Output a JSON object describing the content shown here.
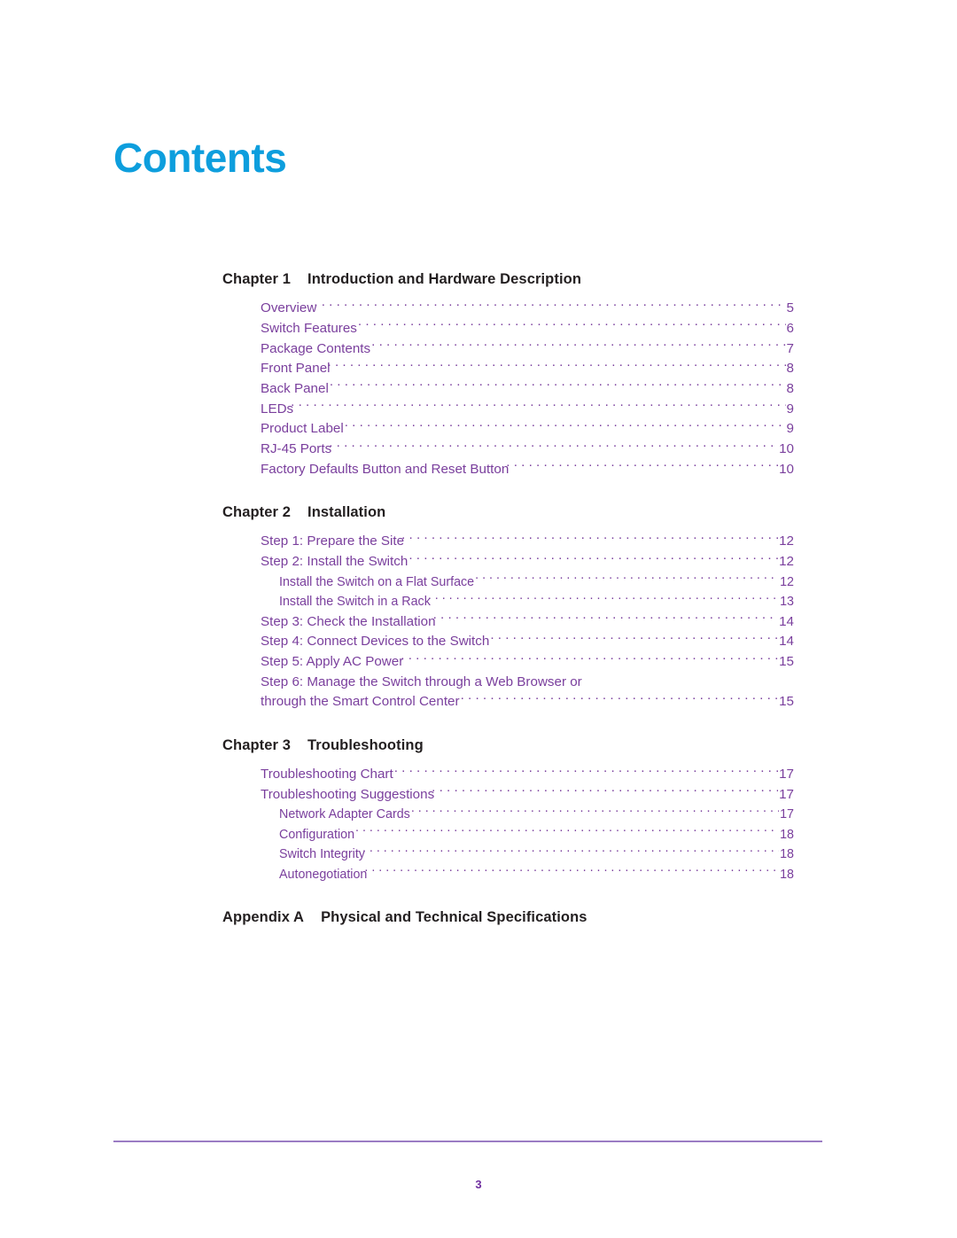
{
  "document": {
    "title": "Contents",
    "title_color": "#0d9edd",
    "entry_color": "#7a3f9d",
    "heading_color": "#231f20",
    "rule_color": "#9b7cc4"
  },
  "sections": [
    {
      "kind": "chapter",
      "number": "Chapter 1",
      "title": "Introduction and Hardware Description",
      "entries": [
        {
          "level": 1,
          "label": "Overview",
          "page": "5",
          "tight": true
        },
        {
          "level": 1,
          "label": "Switch Features",
          "page": "6",
          "tight": false
        },
        {
          "level": 1,
          "label": "Package Contents",
          "page": "7",
          "tight": false
        },
        {
          "level": 1,
          "label": "Front Panel",
          "page": "8",
          "tight": true
        },
        {
          "level": 1,
          "label": "Back Panel",
          "page": "8",
          "tight": false
        },
        {
          "level": 1,
          "label": "LEDs",
          "page": "9",
          "tight": true
        },
        {
          "level": 1,
          "label": "Product Label",
          "page": "9",
          "tight": false
        },
        {
          "level": 1,
          "label": "RJ-45 Ports",
          "page": "10",
          "tight": true
        },
        {
          "level": 1,
          "label": "Factory Defaults Button and Reset Button",
          "page": "10",
          "tight": true
        }
      ]
    },
    {
      "kind": "chapter",
      "number": "Chapter 2",
      "title": "Installation",
      "entries": [
        {
          "level": 1,
          "label": "Step 1: Prepare the Site",
          "page": "12",
          "tight": true
        },
        {
          "level": 1,
          "label": "Step 2: Install the Switch",
          "page": "12",
          "tight": false
        },
        {
          "level": 2,
          "label": "Install the Switch on a Flat Surface",
          "page": "12",
          "tight": false
        },
        {
          "level": 2,
          "label": "Install the Switch in a Rack",
          "page": "13",
          "tight": true
        },
        {
          "level": 1,
          "label": "Step 3: Check the Installation",
          "page": "14",
          "tight": true
        },
        {
          "level": 1,
          "label": "Step 4: Connect Devices to the Switch",
          "page": "14",
          "tight": false
        },
        {
          "level": 1,
          "label": "Step 5: Apply AC Power",
          "page": "15",
          "tight": true
        }
      ],
      "wrapped_entry": {
        "level": 1,
        "line1": "Step 6: Manage the Switch through a Web Browser or",
        "line2": "through the Smart Control Center",
        "page": "15"
      }
    },
    {
      "kind": "chapter",
      "number": "Chapter 3",
      "title": "Troubleshooting",
      "entries": [
        {
          "level": 1,
          "label": "Troubleshooting Chart",
          "page": "17",
          "tight": false
        },
        {
          "level": 1,
          "label": "Troubleshooting Suggestions",
          "page": "17",
          "tight": true
        },
        {
          "level": 2,
          "label": "Network Adapter Cards",
          "page": "17",
          "tight": false
        },
        {
          "level": 2,
          "label": "Configuration",
          "page": "18",
          "tight": false
        },
        {
          "level": 2,
          "label": "Switch Integrity",
          "page": "18",
          "tight": true
        },
        {
          "level": 2,
          "label": "Autonegotiation",
          "page": "18",
          "tight": true
        }
      ]
    },
    {
      "kind": "appendix",
      "number": "Appendix A",
      "title": "Physical and Technical Specifications",
      "entries": []
    }
  ],
  "footer": {
    "page_number": "3"
  }
}
